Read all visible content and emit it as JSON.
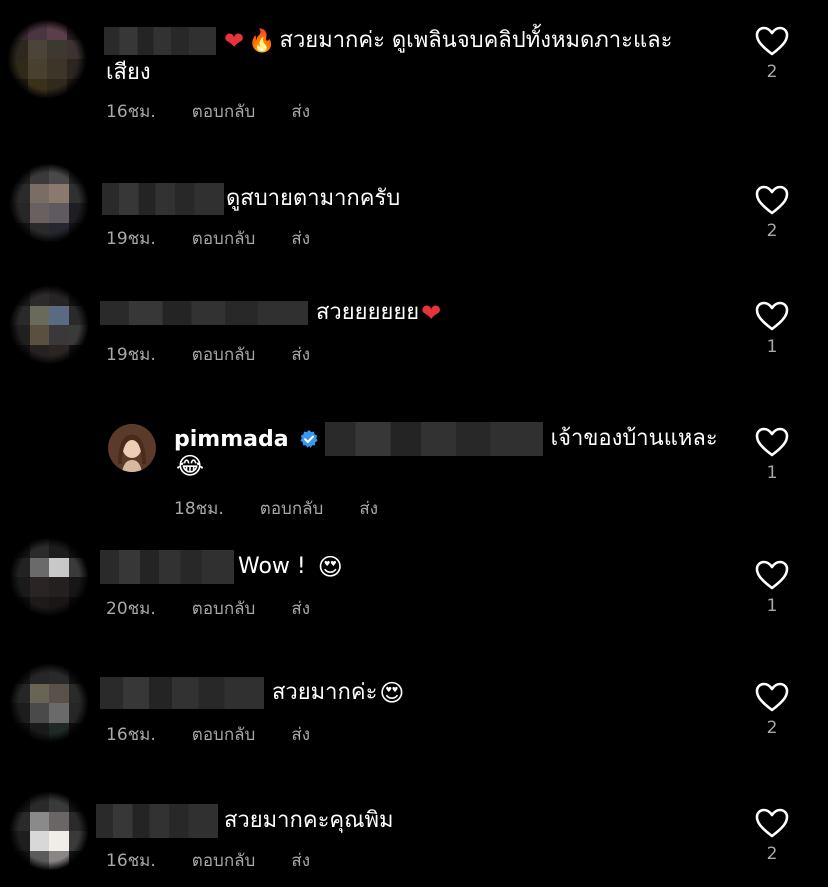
{
  "actions": {
    "reply": "ตอบกลับ",
    "send": "ส่ง"
  },
  "comments": [
    {
      "text_line1": "สวยมากค่ะ ดูเพลินจบคลิปทั้งหมดภาะและ",
      "text_line2": "เสียง",
      "emoji_prefix": [
        "heart",
        "fire"
      ],
      "time": "16ชม.",
      "likes": "2"
    },
    {
      "text_line1": "ดูสบายตามากครับ",
      "time": "19ชม.",
      "likes": "2"
    },
    {
      "text_line1": "สวยยยยยย",
      "emoji_suffix": [
        "heart"
      ],
      "time": "19ชม.",
      "likes": "1"
    },
    {
      "username": "pimmada",
      "verified": true,
      "text_line1": "เจ้าของบ้านแหละ",
      "emoji_line2": [
        "joy"
      ],
      "time": "18ชม.",
      "likes": "1",
      "is_reply": true
    },
    {
      "text_line1": "Wow !",
      "emoji_suffix": [
        "heart-eyes"
      ],
      "time": "20ชม.",
      "likes": "1"
    },
    {
      "text_line1": "สวยมากค่ะ",
      "emoji_suffix": [
        "heart-eyes"
      ],
      "time": "16ชม.",
      "likes": "2"
    },
    {
      "text_line1": "สวยมากคะคุณพิม",
      "time": "16ชม.",
      "likes": "2"
    }
  ],
  "colors": {
    "background": "#000000",
    "text": "#ffffff",
    "muted": "#a8a8a8",
    "verified": "#3897f0",
    "heart": "#e8333d"
  }
}
